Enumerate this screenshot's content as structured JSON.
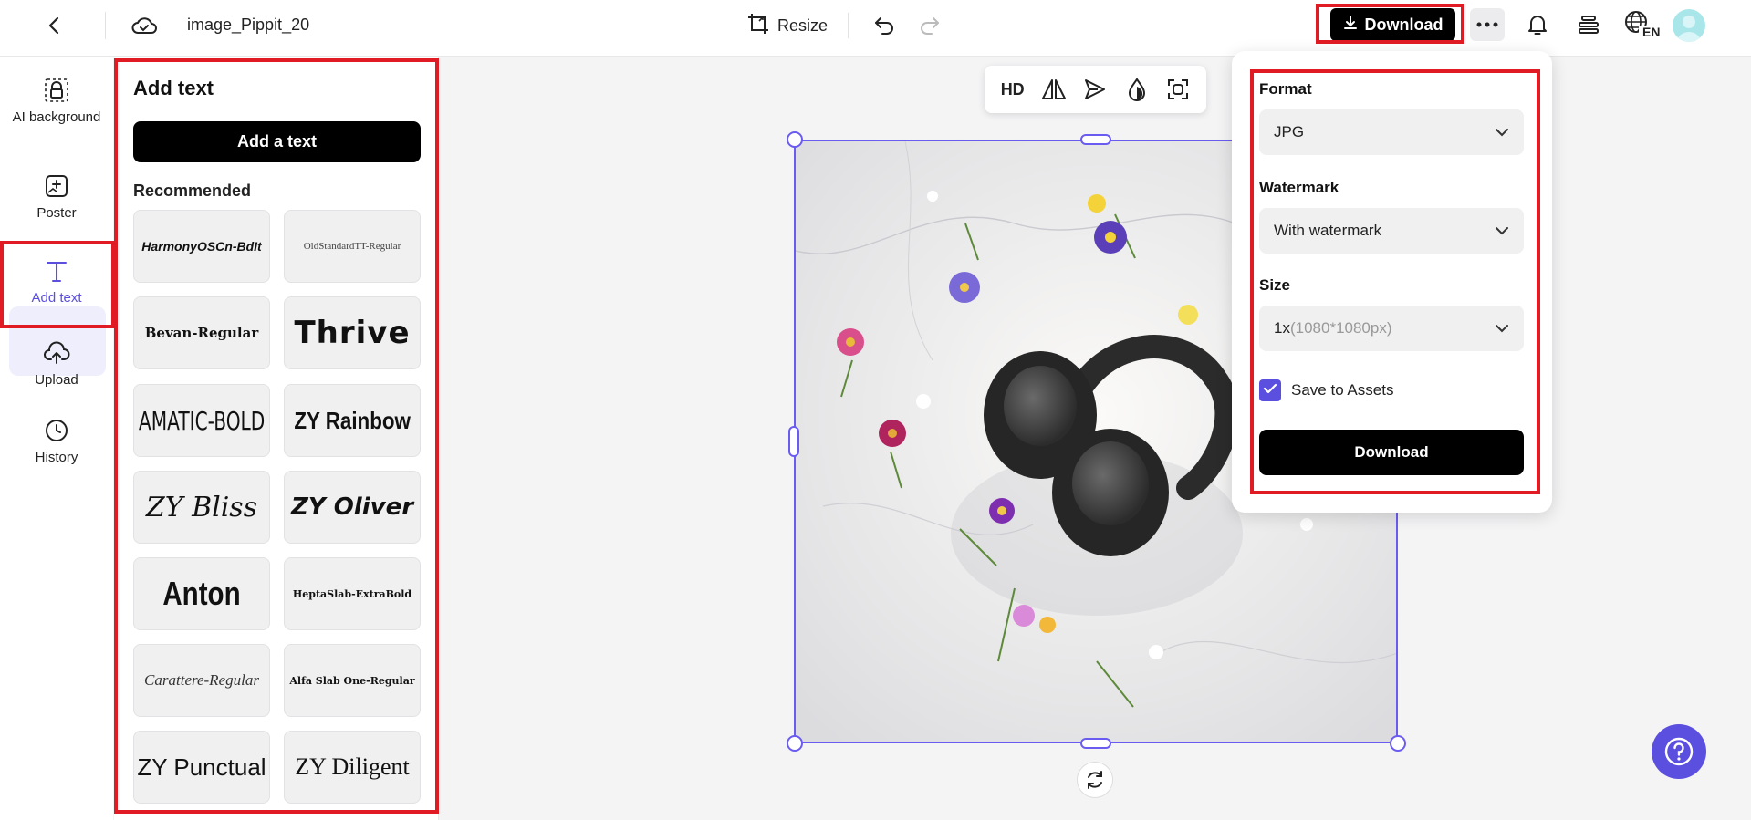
{
  "header": {
    "file_name": "image_Pippit_20",
    "resize_label": "Resize",
    "download_label": "Download",
    "lang_code": "EN"
  },
  "leftnav": {
    "items": [
      {
        "label": "AI background",
        "icon": "ai-background-icon"
      },
      {
        "label": "Poster",
        "icon": "poster-icon"
      },
      {
        "label": "Add text",
        "icon": "text-icon",
        "active": true
      },
      {
        "label": "Upload",
        "icon": "upload-cloud-icon"
      },
      {
        "label": "History",
        "icon": "clock-icon"
      }
    ]
  },
  "panel": {
    "title": "Add text",
    "add_button": "Add a text",
    "recommended_label": "Recommended",
    "fonts": [
      "HarmonyOSCn-BdIt",
      "OldStandardTT-Regular",
      "Bevan-Regular",
      "Thrive",
      "AMATIC-BOLD",
      "ZY Rainbow",
      "ZY Bliss",
      "ZY Oliver",
      "Anton",
      "HeptaSlab-ExtraBold",
      "Carattere-Regular",
      "Alfa Slab One-Regular",
      "ZY Punctual",
      "ZY Diligent"
    ]
  },
  "toolbar": {
    "hd_label": "HD"
  },
  "download_popup": {
    "format_label": "Format",
    "format_value": "JPG",
    "watermark_label": "Watermark",
    "watermark_value": "With watermark",
    "size_label": "Size",
    "size_value": "1x",
    "size_detail": "(1080*1080px)",
    "save_to_assets_label": "Save to Assets",
    "save_to_assets_checked": true,
    "download_button": "Download"
  },
  "colors": {
    "accent": "#5b4fe0",
    "highlight": "#e01b24",
    "selection": "#6a5cf0"
  }
}
